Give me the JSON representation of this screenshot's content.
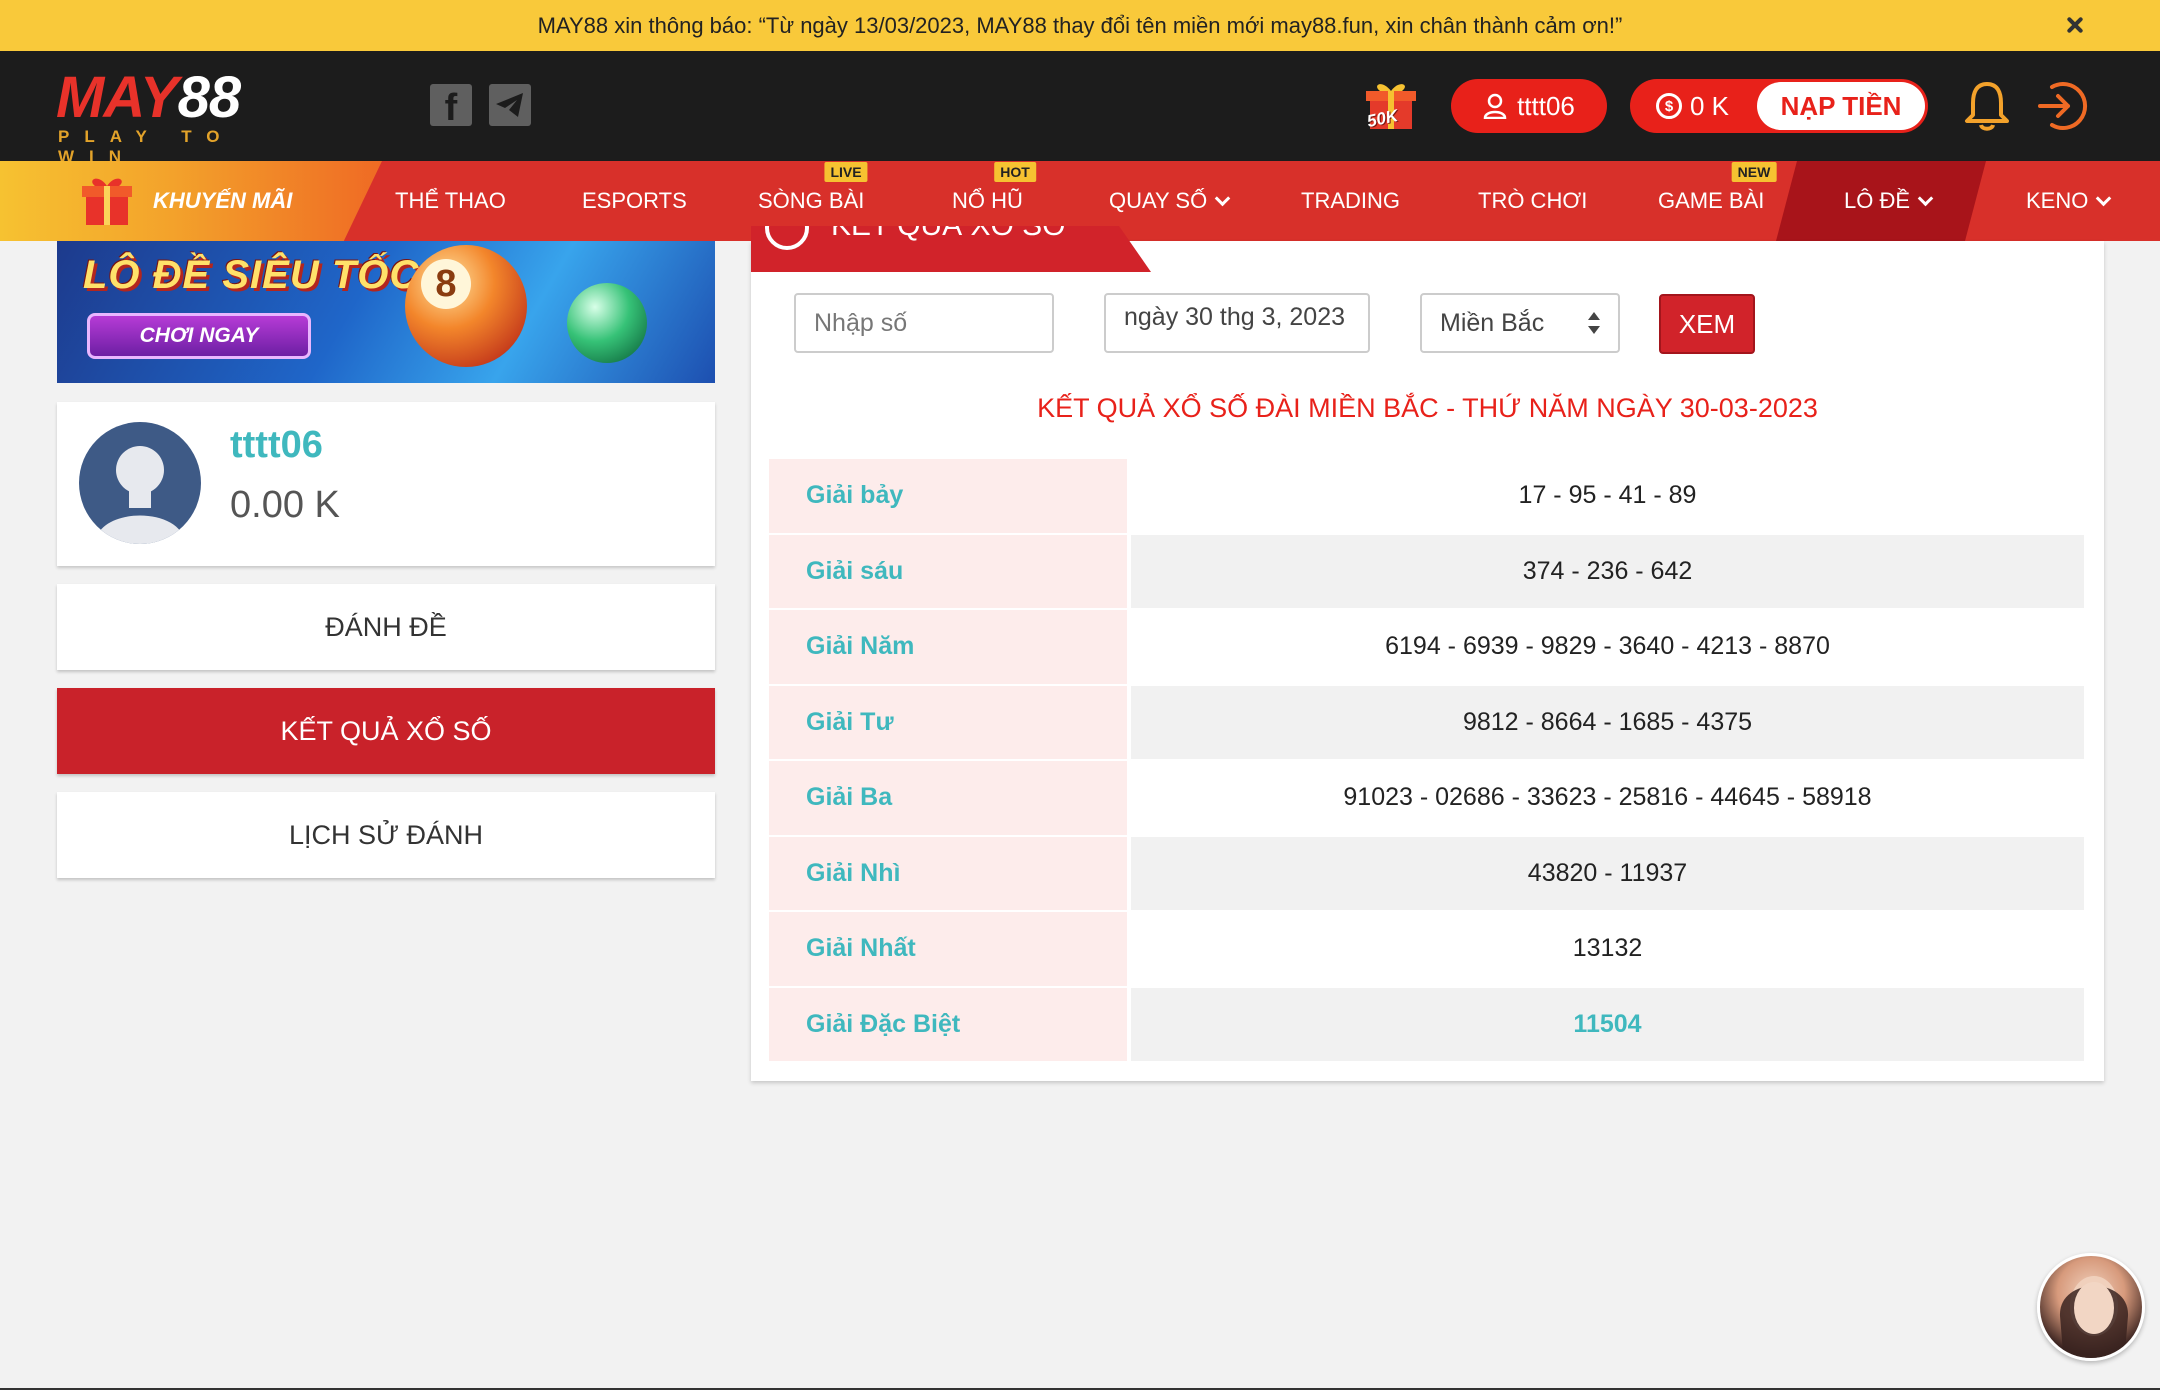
{
  "notice": {
    "text": "MAY88 xin thông báo: “Từ ngày 13/03/2023, MAY88 thay đổi tên miền mới may88.fun, xin chân thành cảm ơn!”"
  },
  "header": {
    "logo_main_a": "MAY",
    "logo_main_b": "88",
    "logo_sub": "PLAY TO WIN",
    "gift_badge": "50K",
    "username": "tttt06",
    "balance": "0 K",
    "deposit_label": "NẠP TIỀN",
    "icons": [
      "facebook-icon",
      "telegram-icon",
      "gift-icon",
      "user-icon",
      "coin-icon",
      "bell-icon",
      "logout-icon"
    ]
  },
  "nav": {
    "promo": "KHUYẾN MÃI",
    "items": [
      {
        "label": "THỂ THAO",
        "badge": ""
      },
      {
        "label": "ESPORTS",
        "badge": ""
      },
      {
        "label": "SÒNG BÀI",
        "badge": "LIVE"
      },
      {
        "label": "NỔ HŨ",
        "badge": "HOT"
      },
      {
        "label": "QUAY SỐ",
        "badge": ""
      },
      {
        "label": "TRADING",
        "badge": ""
      },
      {
        "label": "TRÒ CHƠI",
        "badge": ""
      },
      {
        "label": "GAME BÀI",
        "badge": "NEW"
      },
      {
        "label": "LÔ ĐỀ",
        "badge": ""
      },
      {
        "label": "KENO",
        "badge": ""
      }
    ]
  },
  "banner": {
    "title": "LÔ ĐỀ SIÊU TỐC",
    "cta": "CHƠI NGAY",
    "ball": "8"
  },
  "profile": {
    "name": "tttt06",
    "balance": "0.00 K"
  },
  "sidebar": {
    "bet": "ĐÁNH ĐỀ",
    "results": "KẾT QUẢ XỔ SỐ",
    "history": "LỊCH SỬ ĐÁNH"
  },
  "panel": {
    "tab_label": "KẾT QUẢ XỔ SỐ",
    "number_placeholder": "Nhập số",
    "date_value": "ngày 30 thg 3, 2023",
    "region_value": "Miền Bắc",
    "view_button": "XEM",
    "title": "KẾT QUẢ XỔ SỐ ĐÀI MIỀN BẮC - THỨ NĂM NGÀY 30-03-2023",
    "rows": [
      {
        "label": "Giải bảy",
        "value": "17 - 95 - 41 - 89"
      },
      {
        "label": "Giải sáu",
        "value": "374 - 236 - 642"
      },
      {
        "label": "Giải Năm",
        "value": "6194 - 6939 - 9829 - 3640 - 4213 - 8870"
      },
      {
        "label": "Giải Tư",
        "value": "9812 - 8664 - 1685 - 4375"
      },
      {
        "label": "Giải Ba",
        "value": "91023 - 02686 - 33623 - 25816 - 44645 - 58918"
      },
      {
        "label": "Giải Nhì",
        "value": "43820 - 11937"
      },
      {
        "label": "Giải Nhất",
        "value": "13132"
      },
      {
        "label": "Giải Đặc Biệt",
        "value": "11504"
      }
    ]
  },
  "colors": {
    "accent_red": "#d8302a",
    "notice_yellow": "#f9c93a",
    "teal": "#3fb8be",
    "header_dark": "#1c1c1c"
  }
}
